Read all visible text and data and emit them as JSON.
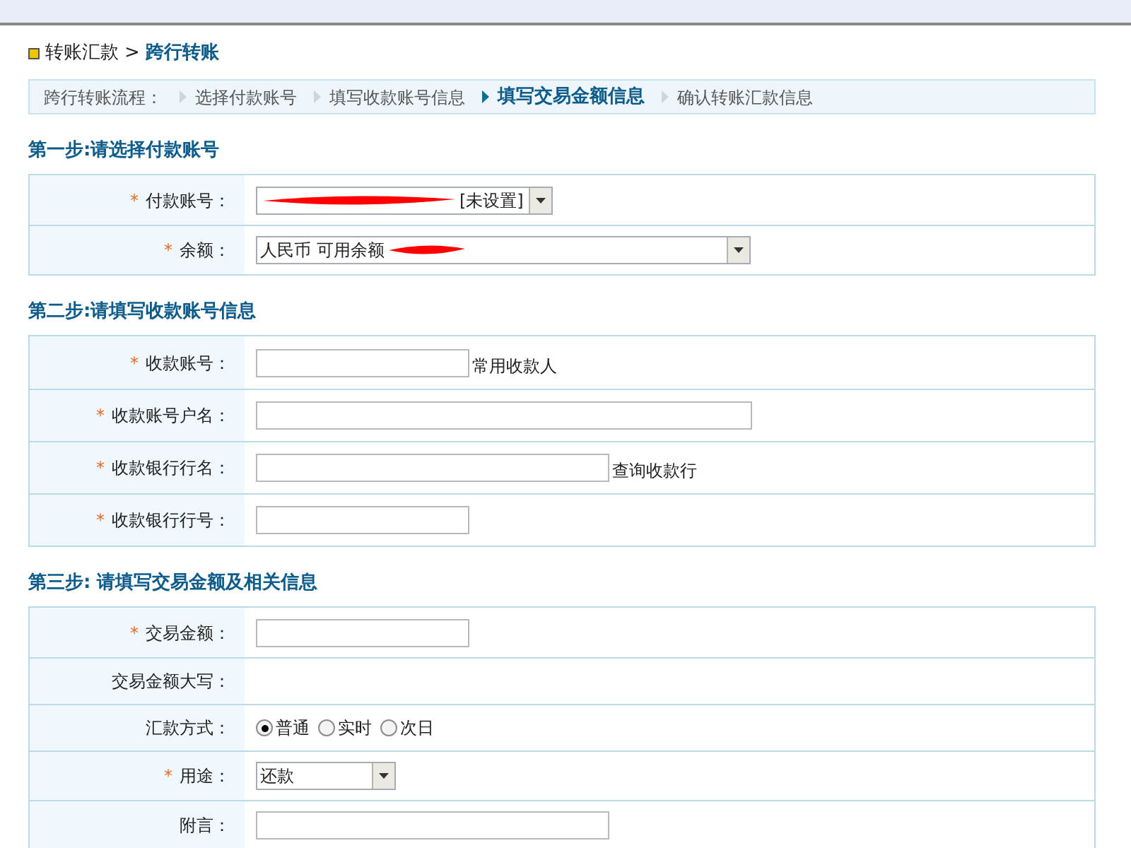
{
  "breadcrumb": {
    "parent": "转账汇款",
    "separator": ">",
    "current": "跨行转账"
  },
  "process": {
    "label": "跨行转账流程：",
    "steps": [
      {
        "label": "选择付款账号",
        "selected": false
      },
      {
        "label": "填写收款账号信息",
        "selected": false
      },
      {
        "label": "填写交易金额信息",
        "selected": true
      },
      {
        "label": "确认转账汇款信息",
        "selected": false
      }
    ]
  },
  "sections": [
    {
      "title": "第一步:请选择付款账号",
      "rows": [
        {
          "marker": "*",
          "label": "付款账号：",
          "kind": "account_select",
          "value": "[未设置]",
          "redacted": true
        },
        {
          "marker": "*",
          "label": "余额：",
          "kind": "long_select",
          "value": "人民币 可用余额",
          "redacted": true
        }
      ]
    },
    {
      "title": "第二步:请填写收款账号信息",
      "rows": [
        {
          "marker": "*",
          "label": "收款账号：",
          "kind": "short_field",
          "link": "常用收款人"
        },
        {
          "marker": "*",
          "label": "收款账号户名：",
          "kind": "long_field"
        },
        {
          "marker": "*",
          "label": "收款银行行名：",
          "kind": "medium_field",
          "link": "查询收款行"
        },
        {
          "marker": "*",
          "label": "收款银行行号：",
          "kind": "short_field"
        }
      ]
    },
    {
      "title": "第三步: 请填写交易金额及相关信息",
      "rows": [
        {
          "marker": "*",
          "label": "交易金额：",
          "kind": "short_field"
        },
        {
          "label": "交易金额大写：",
          "kind": "static"
        },
        {
          "label": "汇款方式：",
          "kind": "radio",
          "options": [
            {
              "label": "普通",
              "selected": true
            },
            {
              "label": "实时",
              "selected": false
            },
            {
              "label": "次日",
              "selected": false
            }
          ]
        },
        {
          "marker": "*",
          "label": "用途：",
          "kind": "short_select",
          "value": "还款"
        },
        {
          "label": "附言：",
          "kind": "medium_field"
        }
      ]
    }
  ]
}
